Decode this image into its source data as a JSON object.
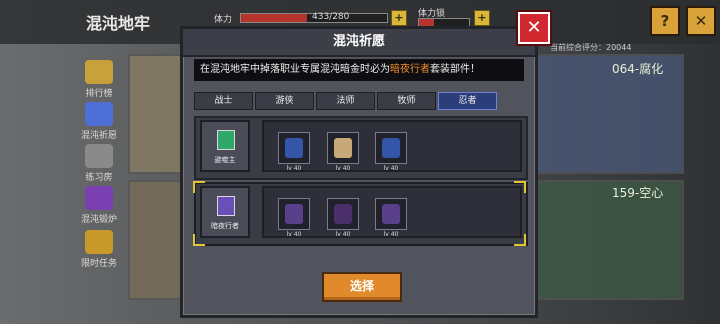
{
  "screen": {
    "title": "混沌地牢"
  },
  "top_bar": {
    "stamina_label": "体力",
    "stamina_value": "433/280",
    "stamina_fill": 0.45,
    "stamina_lock_label": "体力锁",
    "help_icon": "?",
    "close_icon": "✕"
  },
  "sidebar": {
    "items": [
      {
        "label": "排行榜",
        "icon": "trophy-icon",
        "color": "#c9a13a"
      },
      {
        "label": "混沌祈愿",
        "icon": "crystal-icon",
        "color": "#4e6fd6"
      },
      {
        "label": "练习房",
        "icon": "weapon-icon",
        "color": "#8a8a8a"
      },
      {
        "label": "混沌锻炉",
        "icon": "forge-icon",
        "color": "#7a3fb0"
      },
      {
        "label": "限时任务",
        "icon": "lock-icon",
        "color": "#c79a2a"
      }
    ]
  },
  "background_cards": {
    "top_right_label": "当前综合评分：20044",
    "card1_title": "064-腐化",
    "card2_title": "159-空心"
  },
  "dialog": {
    "title": "混沌祈愿",
    "notice_prefix": "在混沌地牢中掉落职业专属混沌暗金时必为",
    "notice_highlight": "暗夜行者",
    "notice_suffix": "套装部件！",
    "tabs": [
      {
        "label": "战士",
        "active": false
      },
      {
        "label": "游侠",
        "active": false
      },
      {
        "label": "法师",
        "active": false
      },
      {
        "label": "牧师",
        "active": false
      },
      {
        "label": "忍者",
        "active": true
      }
    ],
    "sets": [
      {
        "name": "避噬主",
        "selected": false,
        "icon_color": "#2fa86a",
        "items": [
          {
            "icon": "armor-icon",
            "level": "lv 40",
            "color": "#3556a8"
          },
          {
            "icon": "gauntlet-icon",
            "level": "lv 40",
            "color": "#c9a878"
          },
          {
            "icon": "boots-icon",
            "level": "lv 40",
            "color": "#3556a8"
          }
        ]
      },
      {
        "name": "暗夜行者",
        "selected": true,
        "icon_color": "#6a4fb8",
        "items": [
          {
            "icon": "hat-icon",
            "level": "lv 40",
            "color": "#5a3f8a"
          },
          {
            "icon": "robe-icon",
            "level": "lv 40",
            "color": "#4a2f6a"
          },
          {
            "icon": "boots-icon",
            "level": "lv 40",
            "color": "#5a3f8a"
          }
        ]
      }
    ],
    "select_button": "选择"
  }
}
